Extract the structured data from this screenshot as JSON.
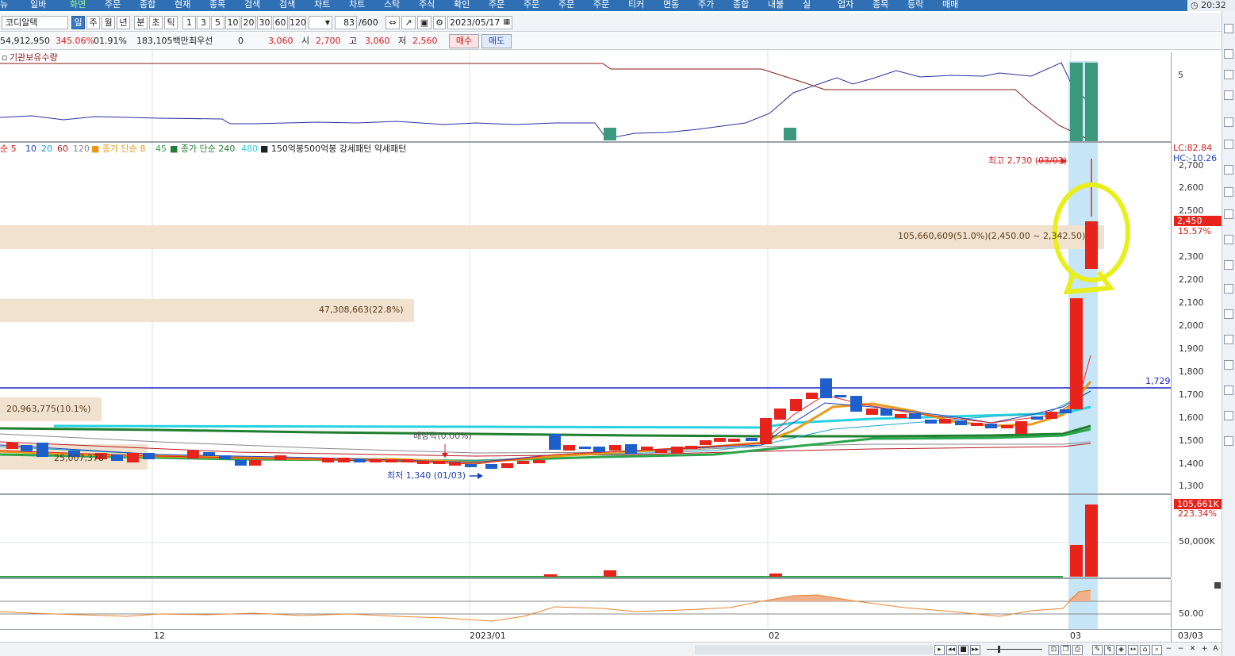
{
  "menu": {
    "items": [
      "뉴",
      "일바",
      "화면",
      "주문",
      "종합",
      "현재",
      "종목",
      "검색",
      "검색",
      "차트",
      "차트",
      "스탁",
      "주식",
      "확인",
      "주문",
      "주문",
      "주문",
      "주문",
      "티커",
      "면동",
      "주가",
      "종합",
      "내불",
      "실",
      "업자",
      "종목",
      "등락",
      "매매"
    ],
    "clock": "20:32"
  },
  "toolbar": {
    "stock_name": "코디알텍",
    "period_buttons": [
      "일",
      "주",
      "월",
      "년",
      "분",
      "초",
      "틱"
    ],
    "interval_buttons": [
      "1",
      "3",
      "5",
      "10",
      "20",
      "30",
      "60",
      "120"
    ],
    "count_value": "83",
    "count_max": "/600",
    "date_value": "2023/05/17"
  },
  "quote": {
    "volume": "54,912,950",
    "change_pct": "345.06%",
    "ratio": "01.91%",
    "amount": "183,105백만",
    "pref_label": "최우선",
    "pref_value": "0",
    "price": "3,060",
    "open_label": "시",
    "open": "2,700",
    "high_label": "고",
    "high": "3,060",
    "low_label": "저",
    "low": "2,560",
    "buy_label": "매수",
    "sell_label": "매도"
  },
  "top_pane": {
    "title": "기관보유수량",
    "tick": "5"
  },
  "price_pane": {
    "legend": [
      {
        "text": "순 5",
        "color": "#d81c1c"
      },
      {
        "text": "10",
        "color": "#1d3fb8"
      },
      {
        "text": "20",
        "color": "#1aa6c7"
      },
      {
        "text": "60",
        "color": "#b8181f"
      },
      {
        "text": "120",
        "color": "#888888"
      },
      {
        "text": "■ 종가 단순 8",
        "color": "#e89a1a"
      },
      {
        "text": "45",
        "color": "#2ba54a"
      },
      {
        "text": "■ 종가 단순 240",
        "color": "#1f7f2f"
      },
      {
        "text": "480",
        "color": "#25d2e0"
      },
      {
        "text": "■ 150억봉500억봉 강세패턴  약세패턴",
        "color": "#222222"
      }
    ],
    "lc": "LC:82.84",
    "hc": "HC:-10.26",
    "ticks": [
      "2,700",
      "2,600",
      "2,500",
      "2,300",
      "2,200",
      "2,100",
      "2,000",
      "1,900",
      "1,800",
      "1,700",
      "1,600",
      "1,500",
      "1,400",
      "1,300"
    ],
    "current_price": "2,450",
    "current_pct": "15.57%",
    "hline_value": "1,729",
    "high_annot": "최고 2,730 (03/03)",
    "low_annot": "최저 1,340 (01/03)",
    "dividend_annot": "배당락(0.00%)",
    "profile_labels": [
      "105,660,609(51.0%)(2,450.00 ~ 2,342.50)",
      "47,308,663(22.8%)",
      "20,963,775(10.1%)",
      "25,007,378"
    ]
  },
  "volume_pane": {
    "current": "105,661K",
    "pct": "223.34%",
    "tick": "50,000K"
  },
  "osc_pane": {
    "tick": "50.00"
  },
  "xaxis": {
    "labels": [
      "12",
      "2023/01",
      "02",
      "03"
    ],
    "last_date": "03/03"
  },
  "colors": {
    "up": "#e8231b",
    "down": "#1f5fcc",
    "highlight": "#c6e6f7",
    "profile": "#f1e2cf",
    "marker": "#e8ef1a"
  }
}
